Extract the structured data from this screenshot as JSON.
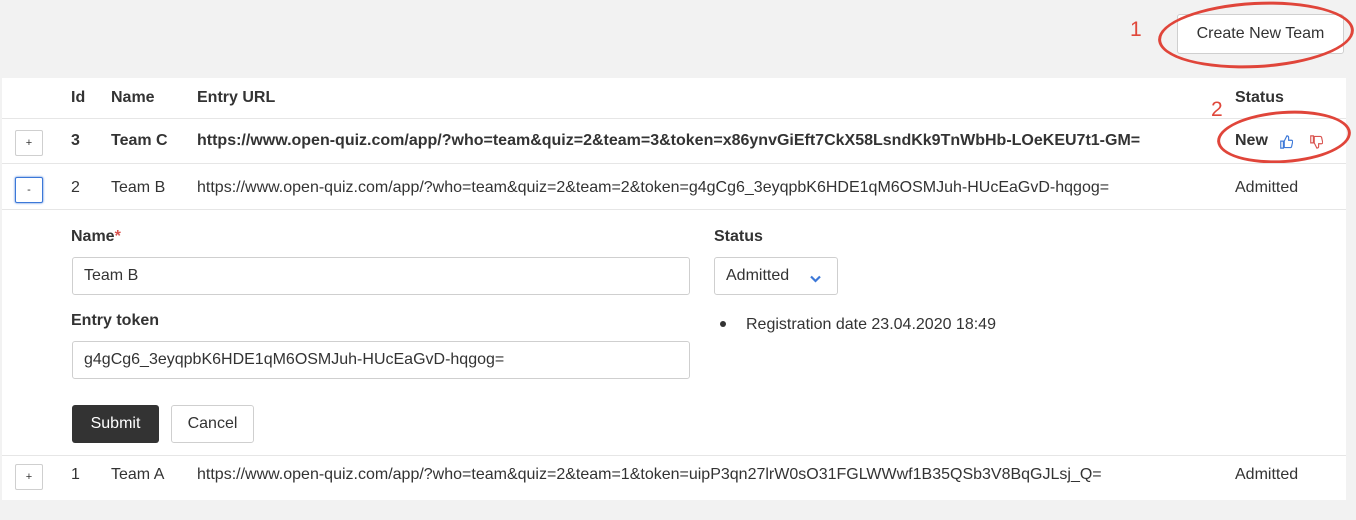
{
  "toolbar": {
    "create_label": "Create New Team"
  },
  "annotations": {
    "one": "1",
    "two": "2"
  },
  "table": {
    "headers": {
      "id": "Id",
      "name": "Name",
      "url": "Entry URL",
      "status": "Status"
    },
    "rows": [
      {
        "toggle": "+",
        "id": "3",
        "name": "Team C",
        "url": "https://www.open-quiz.com/app/?who=team&quiz=2&team=3&token=x86ynvGiEft7CkX58LsndKk9TnWbHb-LOeKEU7t1-GM=",
        "status": "New"
      },
      {
        "toggle": "-",
        "id": "2",
        "name": "Team B",
        "url": "https://www.open-quiz.com/app/?who=team&quiz=2&team=2&token=g4gCg6_3eyqpbK6HDE1qM6OSMJuh-HUcEaGvD-hqgog=",
        "status": "Admitted"
      },
      {
        "toggle": "+",
        "id": "1",
        "name": "Team A",
        "url": "https://www.open-quiz.com/app/?who=team&quiz=2&team=1&token=uipP3qn27lrW0sO31FGLWWwf1B35QSb3V8BqGJLsj_Q=",
        "status": "Admitted"
      }
    ]
  },
  "form": {
    "name_label": "Name",
    "required_mark": "*",
    "name_value": "Team B",
    "token_label": "Entry token",
    "token_value": "g4gCg6_3eyqpbK6HDE1qM6OSMJuh-HUcEaGvD-hqgog=",
    "status_label": "Status",
    "status_value": "Admitted",
    "registration": "Registration date 23.04.2020 18:49",
    "submit_label": "Submit",
    "cancel_label": "Cancel"
  },
  "colors": {
    "annotation": "#e0453a",
    "thumb_up": "#3c78d8",
    "thumb_down": "#d9534f",
    "submit_bg": "#333333"
  }
}
